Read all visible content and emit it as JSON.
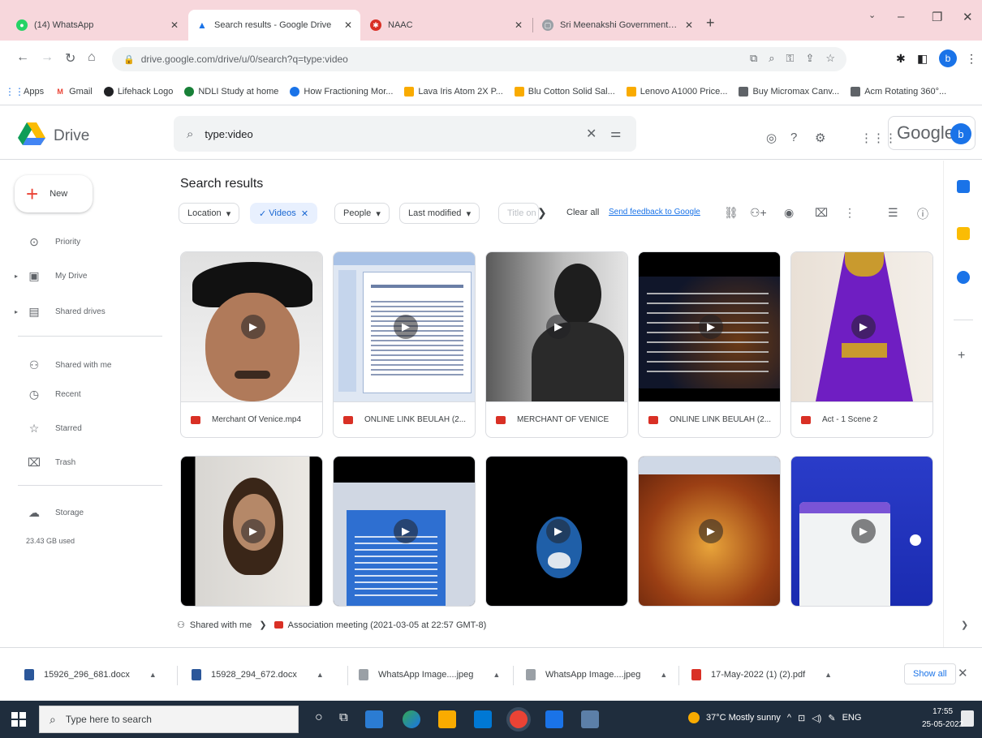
{
  "browser": {
    "tabs": [
      {
        "title": "(14) WhatsApp",
        "favicon_color": "#25d366",
        "active": false
      },
      {
        "title": "Search results - Google Drive",
        "favicon_color": "#1a73e8",
        "active": true
      },
      {
        "title": "NAAC",
        "favicon_color": "#d93025",
        "active": false
      },
      {
        "title": "Sri Meenakshi Government Arts",
        "favicon_color": "#9aa0a6",
        "active": false
      }
    ],
    "url": "drive.google.com/drive/u/0/search?q=type:video",
    "bookmarks": [
      {
        "label": "Apps",
        "color": "#1a73e8"
      },
      {
        "label": "Gmail",
        "color": "#ea4335"
      },
      {
        "label": "Lifehack Logo",
        "color": "#202124"
      },
      {
        "label": "NDLI Study at home",
        "color": "#188038"
      },
      {
        "label": "How Fractioning Mor...",
        "color": "#1a73e8"
      },
      {
        "label": "Lava Iris Atom 2X P...",
        "color": "#f9ab00"
      },
      {
        "label": "Blu Cotton Solid Sal...",
        "color": "#f9ab00"
      },
      {
        "label": "Lenovo A1000 Price...",
        "color": "#f9ab00"
      },
      {
        "label": "Buy Micromax Canv...",
        "color": "#5f6368"
      },
      {
        "label": "Acm Rotating 360°...",
        "color": "#5f6368"
      }
    ],
    "profile_initial": "b"
  },
  "drive": {
    "app_name": "Drive",
    "search_value": "type:video",
    "account_label": "Google",
    "account_initial": "b",
    "new_label": "New",
    "nav": [
      {
        "label": "Priority",
        "icon": "check-circle-icon",
        "glyph": "✓"
      },
      {
        "label": "My Drive",
        "icon": "my-drive-icon",
        "glyph": "▣"
      },
      {
        "label": "Shared drives",
        "icon": "shared-drives-icon",
        "glyph": "▤"
      },
      {
        "label": "Shared with me",
        "icon": "people-icon",
        "glyph": "⚇"
      },
      {
        "label": "Recent",
        "icon": "clock-icon",
        "glyph": "◷"
      },
      {
        "label": "Starred",
        "icon": "star-icon",
        "glyph": "☆"
      },
      {
        "label": "Trash",
        "icon": "trash-icon",
        "glyph": "🗑"
      },
      {
        "label": "Storage",
        "icon": "cloud-icon",
        "glyph": "☁"
      }
    ],
    "storage_used": "23.43 GB used",
    "results_title": "Search results",
    "filters": {
      "location": "Location",
      "videos": "Videos",
      "people": "People",
      "last_modified": "Last modified",
      "title": "Title on",
      "clear_all": "Clear all",
      "feedback": "Send feedback to Google"
    },
    "files": [
      {
        "name": "Merchant Of Venice.mp4"
      },
      {
        "name": "ONLINE LINK BEULAH (2..."
      },
      {
        "name": "MERCHANT OF VENICE"
      },
      {
        "name": "ONLINE LINK BEULAH (2..."
      },
      {
        "name": "Act - 1 Scene 2"
      },
      {
        "name": ""
      },
      {
        "name": ""
      },
      {
        "name": ""
      },
      {
        "name": ""
      },
      {
        "name": ""
      }
    ],
    "breadcrumb": {
      "root": "Shared with me",
      "file": "Association meeting (2021-03-05 at 22:57 GMT-8)"
    }
  },
  "downloads": {
    "items": [
      {
        "name": "15926_296_681.docx",
        "color": "#2b579a"
      },
      {
        "name": "15928_294_672.docx",
        "color": "#2b579a"
      },
      {
        "name": "WhatsApp Image....jpeg",
        "color": "#9aa0a6"
      },
      {
        "name": "WhatsApp Image....jpeg",
        "color": "#9aa0a6"
      },
      {
        "name": "17-May-2022 (1) (2).pdf",
        "color": "#d93025"
      }
    ],
    "show_all": "Show all"
  },
  "taskbar": {
    "search_placeholder": "Type here to search",
    "weather": "37°C  Mostly sunny",
    "lang": "ENG",
    "time": "17:55",
    "date": "25-05-2022"
  }
}
